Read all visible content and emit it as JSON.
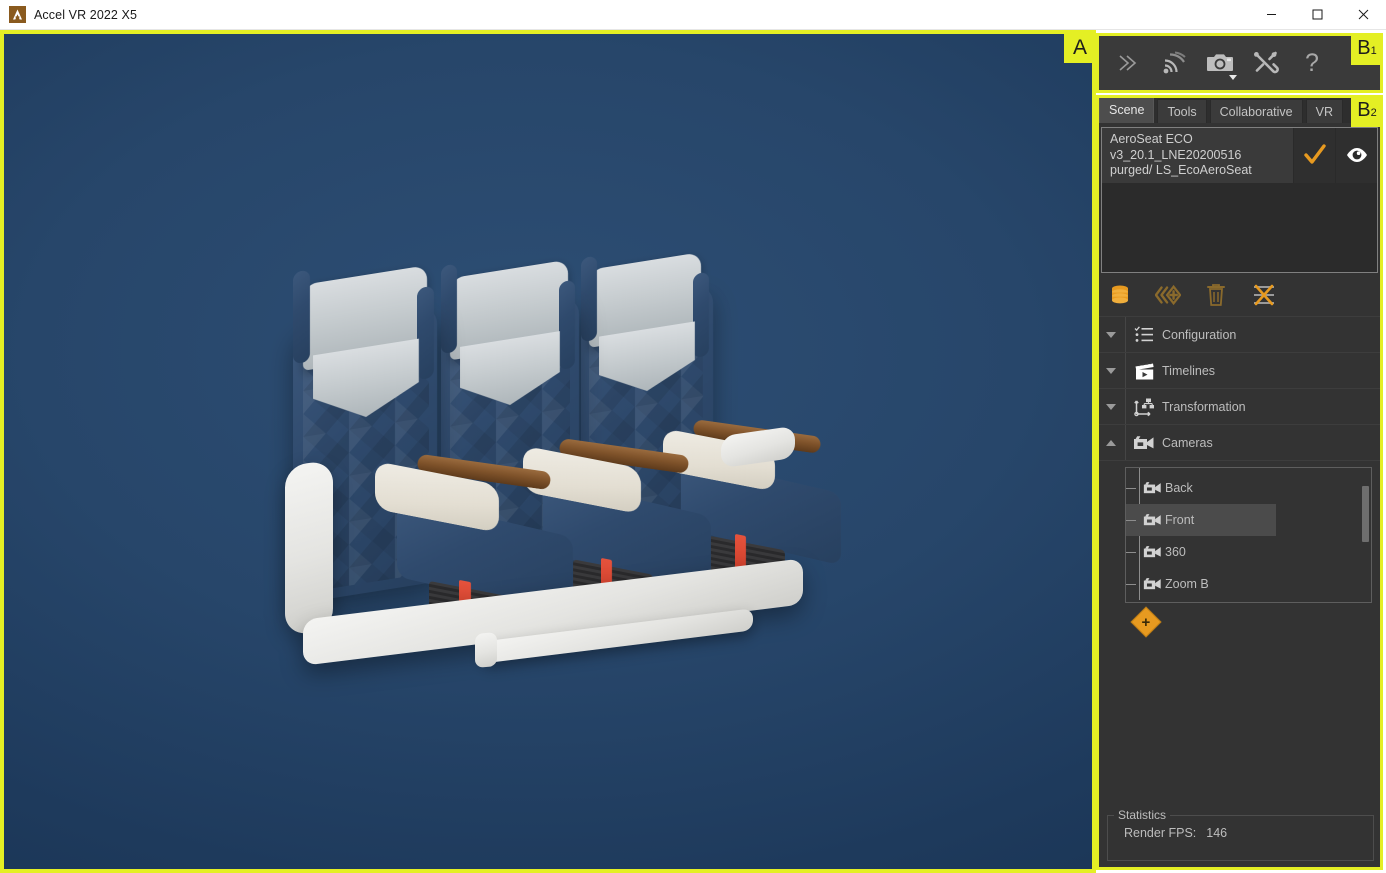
{
  "window": {
    "title": "Accel VR 2022 X5",
    "logo_icon": "accel-a-logo",
    "minimize_icon": "minimize-icon",
    "maximize_icon": "maximize-icon",
    "close_icon": "close-icon"
  },
  "annotations": {
    "viewport": "A",
    "toolbar": "B",
    "toolbar_sub": "1",
    "panel": "B",
    "panel_sub": "2",
    "color": "#e4ef24"
  },
  "viewport": {
    "name": "3d-viewport",
    "background_color": "#27466a",
    "content": "3D render of a three-seat aircraft economy class seat row (AeroSeat ECO)"
  },
  "toolbar": {
    "buttons": [
      {
        "name": "expand-panel-button",
        "icon": "double-chevron-right-icon",
        "label": ""
      },
      {
        "name": "streaming-button",
        "icon": "broadcast-signal-icon",
        "label": ""
      },
      {
        "name": "screenshot-button",
        "icon": "camera-icon",
        "label": "",
        "has_dropdown": true
      },
      {
        "name": "settings-button",
        "icon": "tools-wrench-screwdriver-icon",
        "label": ""
      },
      {
        "name": "help-button",
        "icon": "question-mark-icon",
        "label": ""
      }
    ]
  },
  "tabs": [
    {
      "label": "Scene",
      "active": true
    },
    {
      "label": "Tools",
      "active": false
    },
    {
      "label": "Collaborative",
      "active": false
    },
    {
      "label": "VR",
      "active": false
    }
  ],
  "scene_list": {
    "items": [
      {
        "name": "AeroSeat ECO v3_20.1_LNE20200516 purged/ LS_EcoAeroSeat",
        "check_icon": "checkmark-icon",
        "visibility_icon": "eye-icon"
      }
    ]
  },
  "scene_actions": [
    {
      "name": "database-button",
      "icon": "database-stack-icon"
    },
    {
      "name": "import-button",
      "icon": "import-arrows-plus-icon"
    },
    {
      "name": "delete-button",
      "icon": "trash-icon"
    },
    {
      "name": "clear-button",
      "icon": "cross-lines-icon"
    }
  ],
  "sections": [
    {
      "label": "Configuration",
      "icon": "checklist-icon",
      "expanded": false
    },
    {
      "label": "Timelines",
      "icon": "clapperboard-icon",
      "expanded": false
    },
    {
      "label": "Transformation",
      "icon": "transform-hierarchy-icon",
      "expanded": false
    },
    {
      "label": "Cameras",
      "icon": "camera-video-icon",
      "expanded": true
    }
  ],
  "cameras": {
    "items": [
      {
        "label": "Back",
        "icon": "camera-video-icon",
        "selected": false
      },
      {
        "label": "Front",
        "icon": "camera-video-icon",
        "selected": true
      },
      {
        "label": "360",
        "icon": "camera-video-icon",
        "selected": false
      },
      {
        "label": "Zoom B",
        "icon": "camera-video-icon",
        "selected": false
      }
    ],
    "add_button": {
      "name": "add-camera-button",
      "icon": "plus-diamond-icon"
    }
  },
  "statistics": {
    "legend": "Statistics",
    "render_fps_label": "Render FPS:",
    "render_fps_value": "146"
  }
}
